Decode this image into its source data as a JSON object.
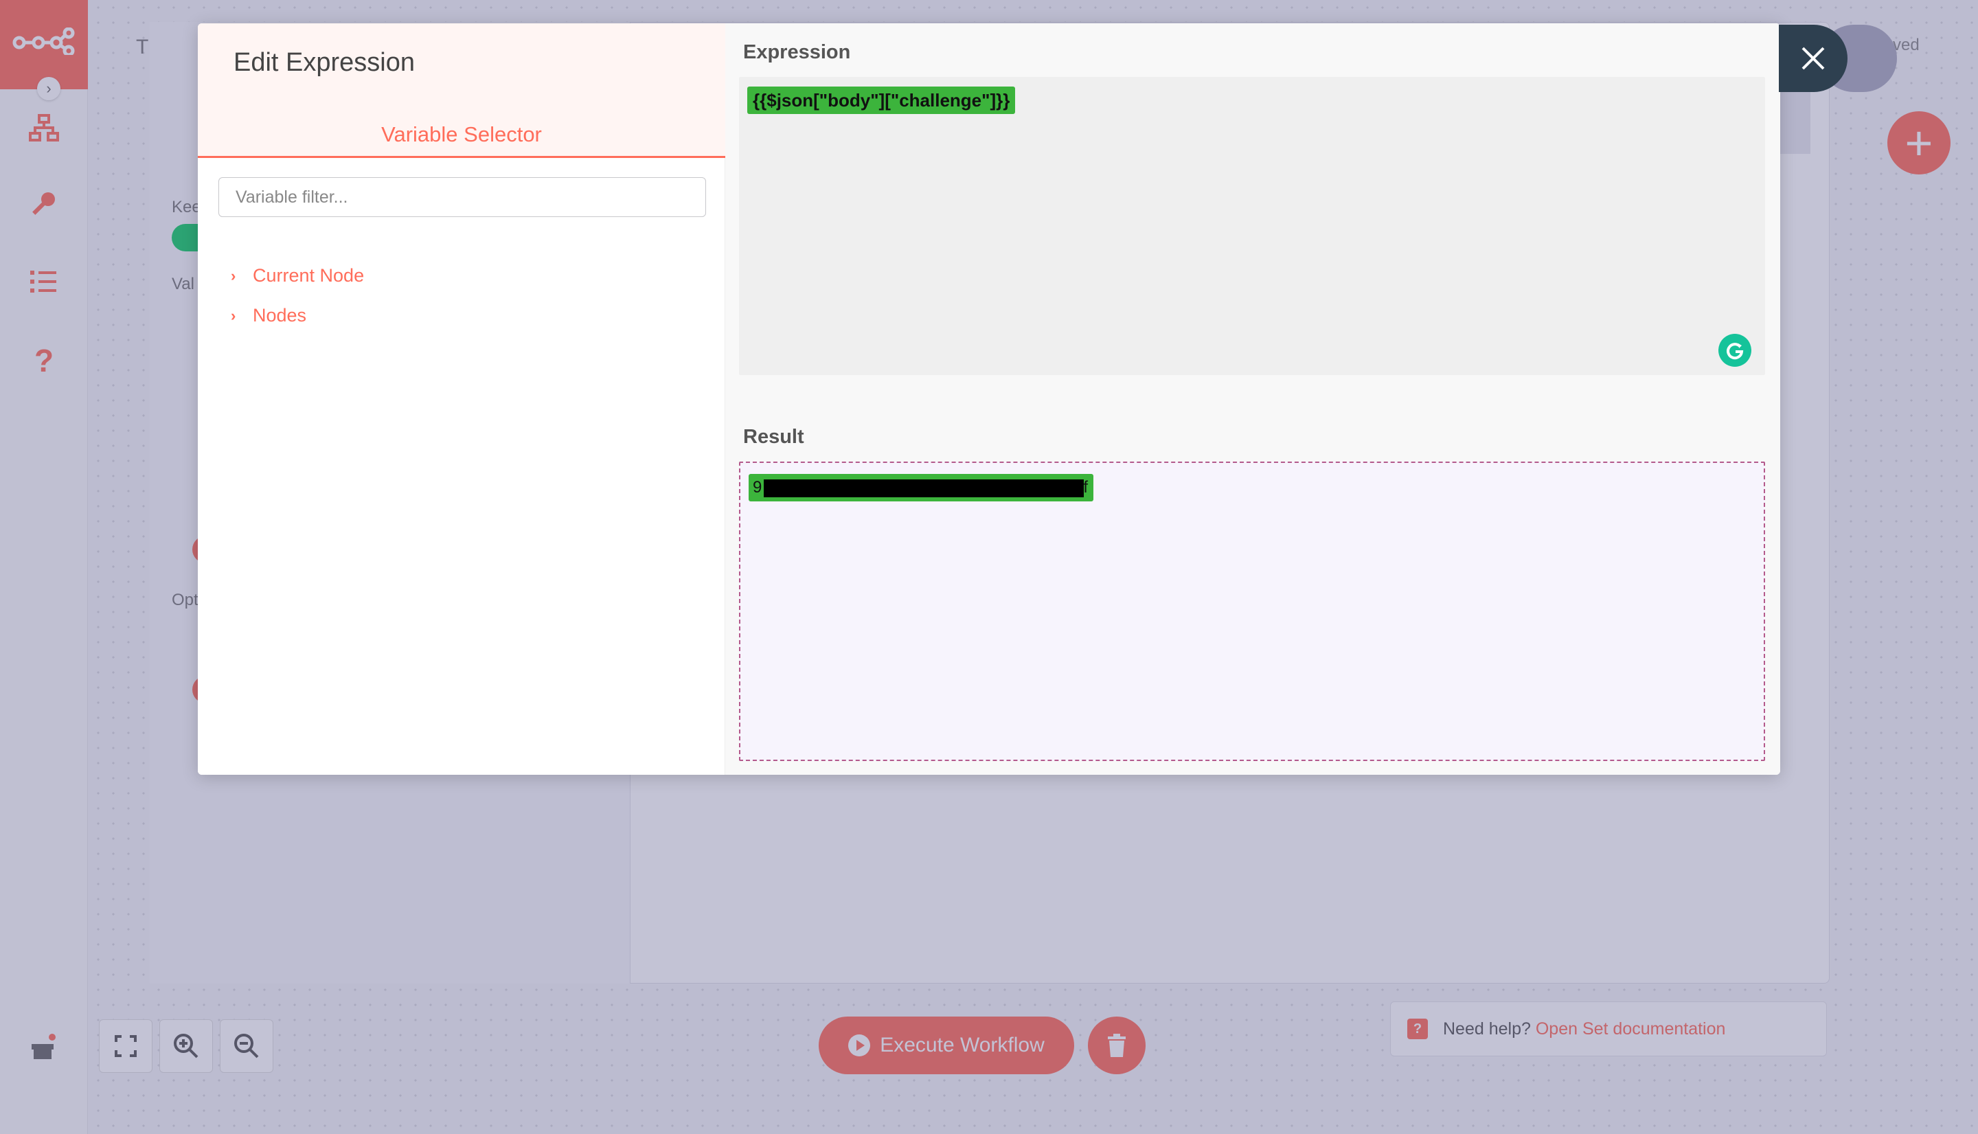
{
  "background": {
    "ndv_title_fragment": "T",
    "keep_label_fragment": "Kee",
    "values_label_fragment": "Val",
    "options_label_fragment": "Opt",
    "saved_fragment": "ved",
    "execute_label": "Execute Workflow",
    "help_prefix": "Need help?",
    "help_link": "Open Set documentation"
  },
  "dialog": {
    "title": "Edit Expression",
    "variable_selector_tab": "Variable Selector",
    "filter_placeholder": "Variable filter...",
    "tree": [
      {
        "label": "Current Node"
      },
      {
        "label": "Nodes"
      }
    ],
    "expression_label": "Expression",
    "expression_value": "{{$json[\"body\"][\"challenge\"]}}",
    "result_label": "Result",
    "result_start": "9",
    "result_end": "f"
  },
  "colors": {
    "brand": "#ff6d5a",
    "highlight": "#3cb43c",
    "close_button": "#2e4050",
    "grammarly": "#15c39a"
  },
  "icons": [
    "n8n-logo-icon",
    "chevron-right-icon",
    "workflows-icon",
    "key-icon",
    "executions-icon",
    "help-icon",
    "gift-icon",
    "fullscreen-icon",
    "zoom-in-icon",
    "zoom-out-icon",
    "trash-icon",
    "close-icon",
    "grammarly-icon"
  ]
}
